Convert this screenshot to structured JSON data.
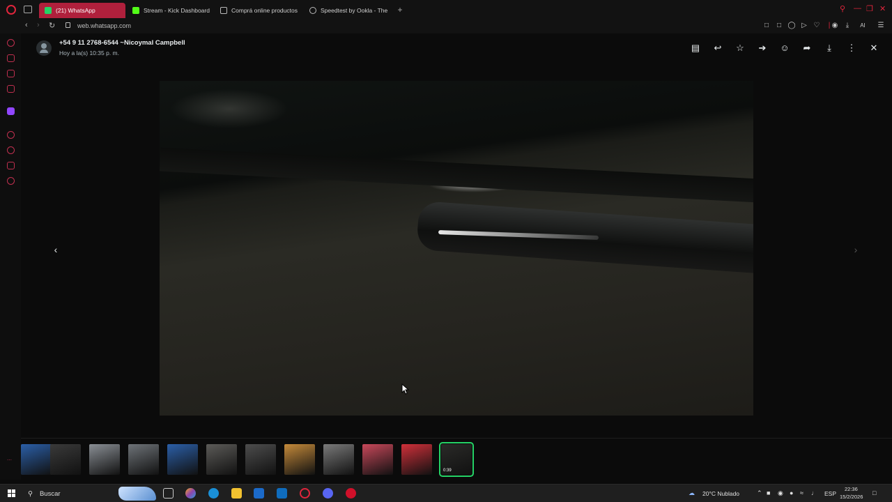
{
  "browser": {
    "tabs": [
      {
        "label": "(21) WhatsApp",
        "badge": "21",
        "active": true,
        "icon": "whatsapp-icon"
      },
      {
        "label": "Stream - Kick Dashboard",
        "active": false,
        "icon": "kick-icon"
      },
      {
        "label": "Comprá online productos",
        "active": false,
        "icon": "document-icon"
      },
      {
        "label": "Speedtest by Ookla - The",
        "active": false,
        "icon": "speedtest-icon"
      }
    ],
    "new_tab_glyph": "+",
    "url": "web.whatsapp.com",
    "toolbar_ai_label": "AI"
  },
  "viewer": {
    "sender": "+54 9 11 2768-6544 ~Nicoymal Campbell",
    "timestamp": "Hoy a la(s) 10:35 p. m.",
    "actions": [
      "chat-icon",
      "reply-icon",
      "star-icon",
      "pin-icon",
      "emoji-icon",
      "forward-icon",
      "download-icon",
      "more-icon",
      "close-icon"
    ],
    "thumbnails": [
      {
        "kind": "image",
        "color": "#2b5fa8"
      },
      {
        "kind": "image",
        "color": "#3a3a3a"
      },
      {
        "kind": "image",
        "color": "#8a8f95"
      },
      {
        "kind": "image",
        "color": "#6e7378"
      },
      {
        "kind": "image",
        "color": "#2b5fa8"
      },
      {
        "kind": "image",
        "color": "#5c5b58"
      },
      {
        "kind": "image",
        "color": "#4d4d4d"
      },
      {
        "kind": "image",
        "color": "#c58a3a"
      },
      {
        "kind": "image",
        "color": "#7a7a7a"
      },
      {
        "kind": "image",
        "color": "#c8485a"
      },
      {
        "kind": "image",
        "color": "#d0303a"
      },
      {
        "kind": "video",
        "color": "#2a2a28",
        "duration": "0:39",
        "selected": true
      }
    ]
  },
  "taskbar": {
    "search_placeholder": "Buscar",
    "weather": "20°C  Nublado",
    "language": "ESP",
    "time": "22:36",
    "date": "15/2/2026"
  },
  "colors": {
    "accent_opera": "#e0253c",
    "whatsapp_green": "#25d366",
    "active_tab": "#b0203c"
  }
}
